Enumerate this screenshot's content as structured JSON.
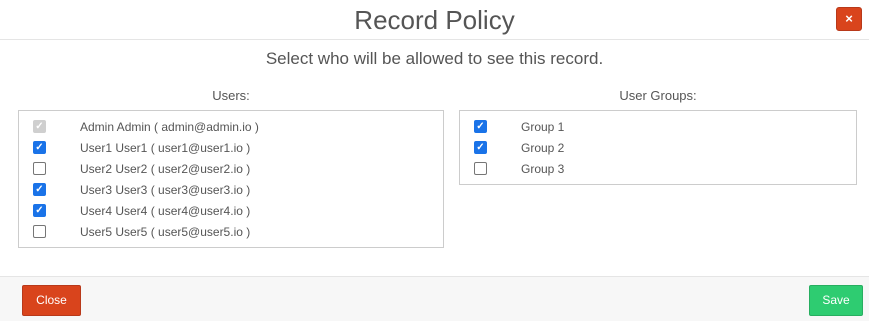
{
  "header": {
    "title": "Record Policy",
    "close_icon": "×"
  },
  "body": {
    "subtitle": "Select who will be allowed to see this record.",
    "users": {
      "label": "Users:",
      "items": [
        {
          "label": "Admin Admin ( admin@admin.io )",
          "checked": true,
          "disabled": true
        },
        {
          "label": "User1 User1 ( user1@user1.io )",
          "checked": true,
          "disabled": false
        },
        {
          "label": "User2 User2 ( user2@user2.io )",
          "checked": false,
          "disabled": false
        },
        {
          "label": "User3 User3 ( user3@user3.io )",
          "checked": true,
          "disabled": false
        },
        {
          "label": "User4 User4 ( user4@user4.io )",
          "checked": true,
          "disabled": false
        },
        {
          "label": "User5 User5 ( user5@user5.io )",
          "checked": false,
          "disabled": false
        }
      ]
    },
    "groups": {
      "label": "User Groups:",
      "items": [
        {
          "label": "Group 1",
          "checked": true,
          "disabled": false
        },
        {
          "label": "Group 2",
          "checked": true,
          "disabled": false
        },
        {
          "label": "Group 3",
          "checked": false,
          "disabled": false
        }
      ]
    }
  },
  "footer": {
    "close_label": "Close",
    "save_label": "Save"
  },
  "colors": {
    "danger": "#d9441c",
    "success": "#2ecc71",
    "checkbox": "#1a73e8"
  }
}
